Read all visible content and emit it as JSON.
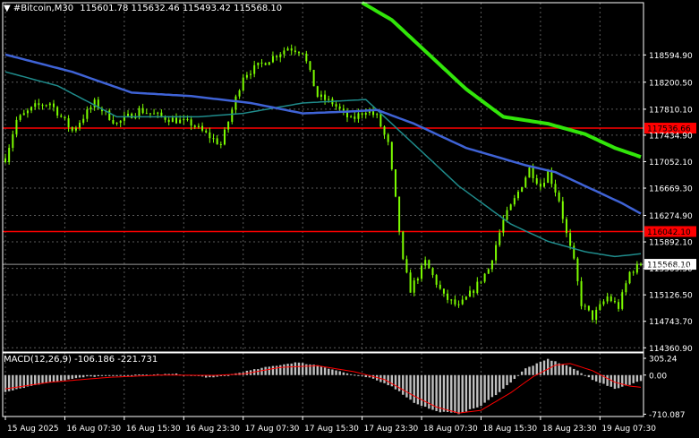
{
  "header": {
    "arrow": "▼",
    "symbol": "#Bitcoin,M30",
    "open": "115601.78",
    "high": "115632.46",
    "low": "115493.42",
    "close": "115568.10"
  },
  "colors": {
    "background": "#000000",
    "grid": "#5a5a5a",
    "candle": "#7CFC00",
    "ma_fast": "#1f8b8b",
    "ma_mid": "#3f63d6",
    "ma_slow": "#32e60a",
    "hline": "#ff0000",
    "macd_hist": "#c0c0c0",
    "macd_signal": "#ff0000",
    "text": "#ffffff"
  },
  "chart_data": [
    {
      "type": "candlestick",
      "instrument": "#Bitcoin,M30",
      "ylim": [
        114300,
        119350
      ],
      "y_ticks": [
        "118594.90",
        "118200.50",
        "117810.10",
        "117434.90",
        "117052.10",
        "116669.30",
        "116274.90",
        "115892.10",
        "115509.50",
        "115126.50",
        "114743.70",
        "114360.90"
      ],
      "x_ticks": [
        "15 Aug 2025",
        "16 Aug 07:30",
        "16 Aug 15:30",
        "16 Aug 23:30",
        "17 Aug 07:30",
        "17 Aug 15:30",
        "17 Aug 23:30",
        "18 Aug 07:30",
        "18 Aug 15:30",
        "18 Aug 23:30",
        "19 Aug 07:30"
      ],
      "x_tick_bars": [
        0,
        16,
        32,
        48,
        64,
        80,
        96,
        112,
        128,
        144,
        160
      ],
      "bar_count": 172,
      "price_anchors": [
        [
          0,
          117100
        ],
        [
          3,
          117650
        ],
        [
          8,
          117850
        ],
        [
          12,
          117900
        ],
        [
          18,
          117500
        ],
        [
          24,
          117900
        ],
        [
          30,
          117600
        ],
        [
          36,
          117800
        ],
        [
          42,
          117700
        ],
        [
          50,
          117600
        ],
        [
          58,
          117300
        ],
        [
          64,
          118300
        ],
        [
          70,
          118500
        ],
        [
          76,
          118700
        ],
        [
          80,
          118650
        ],
        [
          84,
          118000
        ],
        [
          88,
          117900
        ],
        [
          93,
          117650
        ],
        [
          97,
          117800
        ],
        [
          100,
          117700
        ],
        [
          103,
          117300
        ],
        [
          105,
          116500
        ],
        [
          107,
          115600
        ],
        [
          109,
          115200
        ],
        [
          113,
          115600
        ],
        [
          118,
          115100
        ],
        [
          122,
          114950
        ],
        [
          126,
          115200
        ],
        [
          130,
          115500
        ],
        [
          134,
          116200
        ],
        [
          137,
          116500
        ],
        [
          141,
          116950
        ],
        [
          144,
          116700
        ],
        [
          146,
          116900
        ],
        [
          149,
          116500
        ],
        [
          151,
          116000
        ],
        [
          153,
          115600
        ],
        [
          155,
          115000
        ],
        [
          158,
          114800
        ],
        [
          162,
          115100
        ],
        [
          165,
          114950
        ],
        [
          168,
          115450
        ],
        [
          171,
          115568
        ]
      ],
      "moving_averages": [
        {
          "role": "fast",
          "anchors": [
            [
              0,
              118350
            ],
            [
              14,
              118150
            ],
            [
              30,
              117700
            ],
            [
              52,
              117700
            ],
            [
              64,
              117750
            ],
            [
              80,
              117900
            ],
            [
              97,
              117950
            ],
            [
              102,
              117700
            ],
            [
              110,
              117300
            ],
            [
              122,
              116700
            ],
            [
              136,
              116150
            ],
            [
              146,
              115900
            ],
            [
              156,
              115750
            ],
            [
              164,
              115680
            ],
            [
              171,
              115720
            ]
          ]
        },
        {
          "role": "mid",
          "anchors": [
            [
              0,
              118600
            ],
            [
              18,
              118350
            ],
            [
              34,
              118050
            ],
            [
              50,
              118000
            ],
            [
              66,
              117900
            ],
            [
              80,
              117750
            ],
            [
              94,
              117780
            ],
            [
              100,
              117800
            ],
            [
              110,
              117600
            ],
            [
              124,
              117250
            ],
            [
              140,
              117000
            ],
            [
              148,
              116900
            ],
            [
              158,
              116650
            ],
            [
              166,
              116450
            ],
            [
              171,
              116300
            ]
          ]
        },
        {
          "role": "slow",
          "anchors": [
            [
              96,
              119350
            ],
            [
              104,
              119100
            ],
            [
              114,
              118600
            ],
            [
              124,
              118100
            ],
            [
              134,
              117700
            ],
            [
              146,
              117600
            ],
            [
              156,
              117450
            ],
            [
              164,
              117250
            ],
            [
              171,
              117120
            ]
          ]
        }
      ],
      "horizontal_lines": [
        {
          "value": 117536.66,
          "label": "117536.66"
        },
        {
          "value": 116042.1,
          "label": "116042.10"
        }
      ],
      "last_price": {
        "value": 115568.1,
        "label": "115568.10"
      }
    },
    {
      "type": "histogram",
      "indicator": "MACD(12,26,9)",
      "values_header": [
        "-106.186",
        "-221.731"
      ],
      "ylim": [
        -720,
        305.24
      ],
      "y_ticks": [
        "305.24",
        "0.00",
        "-710.087"
      ],
      "hist_anchors": [
        [
          0,
          -300
        ],
        [
          10,
          -150
        ],
        [
          22,
          -30
        ],
        [
          34,
          0
        ],
        [
          46,
          20
        ],
        [
          56,
          -50
        ],
        [
          62,
          30
        ],
        [
          70,
          140
        ],
        [
          78,
          230
        ],
        [
          84,
          180
        ],
        [
          92,
          30
        ],
        [
          98,
          -50
        ],
        [
          104,
          -200
        ],
        [
          110,
          -500
        ],
        [
          116,
          -660
        ],
        [
          122,
          -700
        ],
        [
          128,
          -560
        ],
        [
          134,
          -250
        ],
        [
          140,
          120
        ],
        [
          146,
          290
        ],
        [
          152,
          150
        ],
        [
          158,
          -80
        ],
        [
          164,
          -250
        ],
        [
          168,
          -170
        ],
        [
          171,
          -106
        ]
      ],
      "signal_anchors": [
        [
          0,
          -250
        ],
        [
          12,
          -130
        ],
        [
          28,
          -40
        ],
        [
          42,
          0
        ],
        [
          56,
          -5
        ],
        [
          64,
          20
        ],
        [
          74,
          140
        ],
        [
          84,
          170
        ],
        [
          94,
          60
        ],
        [
          102,
          -80
        ],
        [
          110,
          -380
        ],
        [
          116,
          -580
        ],
        [
          122,
          -690
        ],
        [
          128,
          -640
        ],
        [
          136,
          -320
        ],
        [
          142,
          -30
        ],
        [
          148,
          180
        ],
        [
          152,
          210
        ],
        [
          158,
          80
        ],
        [
          164,
          -130
        ],
        [
          168,
          -200
        ],
        [
          171,
          -222
        ]
      ]
    }
  ]
}
